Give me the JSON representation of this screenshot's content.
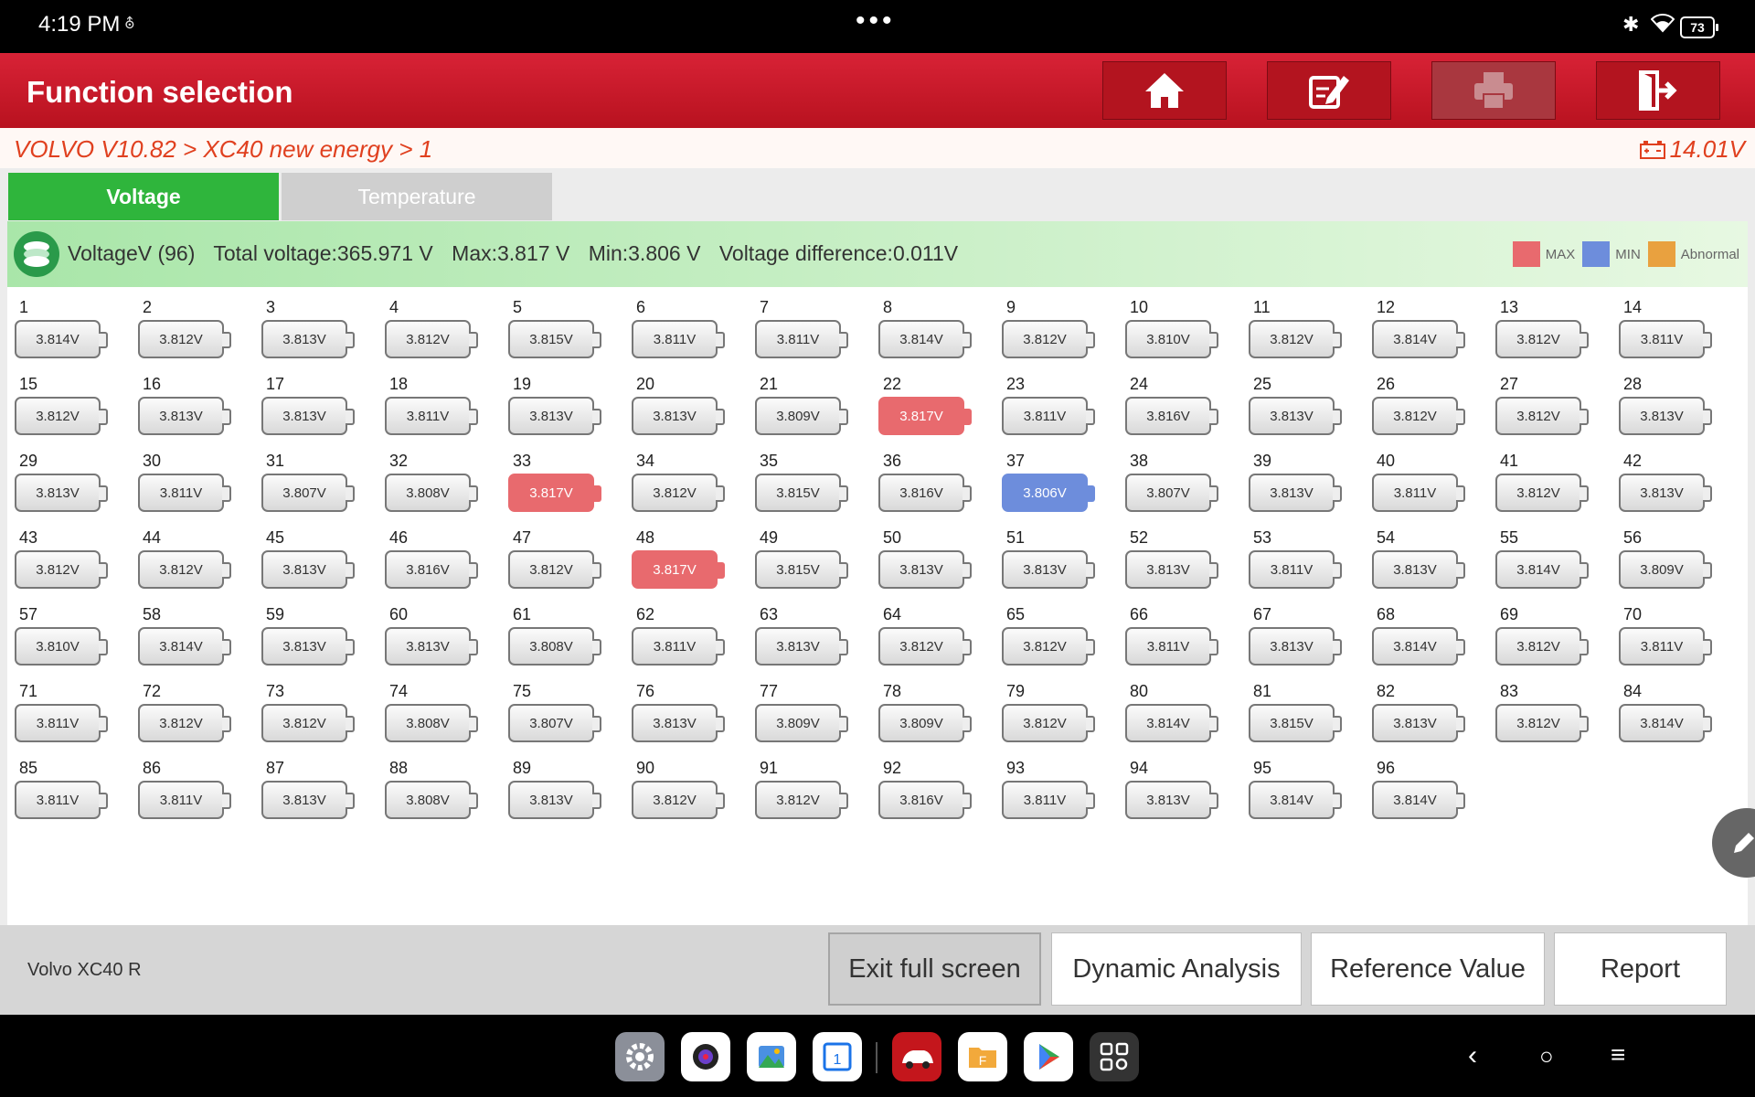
{
  "status": {
    "time": "4:19 PM",
    "battery": "73"
  },
  "header": {
    "title": "Function selection"
  },
  "breadcrumb": {
    "path": "VOLVO V10.82 > XC40 new energy  > 1",
    "battery_voltage": "14.01V"
  },
  "tabs": [
    {
      "label": "Voltage",
      "active": true
    },
    {
      "label": "Temperature",
      "active": false
    }
  ],
  "info": {
    "label": "VoltageV (96)",
    "total": "Total voltage:365.971 V",
    "max": "Max:3.817 V",
    "min": "Min:3.806 V",
    "difference": "Voltage difference:0.011V"
  },
  "legend": [
    {
      "label": "MAX",
      "color": "#e86a6e"
    },
    {
      "label": "MIN",
      "color": "#6d8ddc"
    },
    {
      "label": "Abnormal",
      "color": "#e9a13f"
    }
  ],
  "cells": [
    "3.814V",
    "3.812V",
    "3.813V",
    "3.812V",
    "3.815V",
    "3.811V",
    "3.811V",
    "3.814V",
    "3.812V",
    "3.810V",
    "3.812V",
    "3.814V",
    "3.812V",
    "3.811V",
    "3.812V",
    "3.813V",
    "3.813V",
    "3.811V",
    "3.813V",
    "3.813V",
    "3.809V",
    "3.817V",
    "3.811V",
    "3.816V",
    "3.813V",
    "3.812V",
    "3.812V",
    "3.813V",
    "3.813V",
    "3.811V",
    "3.807V",
    "3.808V",
    "3.817V",
    "3.812V",
    "3.815V",
    "3.816V",
    "3.806V",
    "3.807V",
    "3.813V",
    "3.811V",
    "3.812V",
    "3.813V",
    "3.812V",
    "3.812V",
    "3.813V",
    "3.816V",
    "3.812V",
    "3.817V",
    "3.815V",
    "3.813V",
    "3.813V",
    "3.813V",
    "3.811V",
    "3.813V",
    "3.814V",
    "3.809V",
    "3.810V",
    "3.814V",
    "3.813V",
    "3.813V",
    "3.808V",
    "3.811V",
    "3.813V",
    "3.812V",
    "3.812V",
    "3.811V",
    "3.813V",
    "3.814V",
    "3.812V",
    "3.811V",
    "3.811V",
    "3.812V",
    "3.812V",
    "3.808V",
    "3.807V",
    "3.813V",
    "3.809V",
    "3.809V",
    "3.812V",
    "3.814V",
    "3.815V",
    "3.813V",
    "3.812V",
    "3.814V",
    "3.811V",
    "3.811V",
    "3.813V",
    "3.808V",
    "3.813V",
    "3.812V",
    "3.812V",
    "3.816V",
    "3.811V",
    "3.813V",
    "3.814V",
    "3.814V"
  ],
  "max_cells": [
    22,
    33,
    48
  ],
  "min_cells": [
    37
  ],
  "footer": {
    "vehicle": "Volvo XC40 R",
    "buttons": [
      "Exit full screen",
      "Dynamic Analysis",
      "Reference Value",
      "Report"
    ]
  }
}
